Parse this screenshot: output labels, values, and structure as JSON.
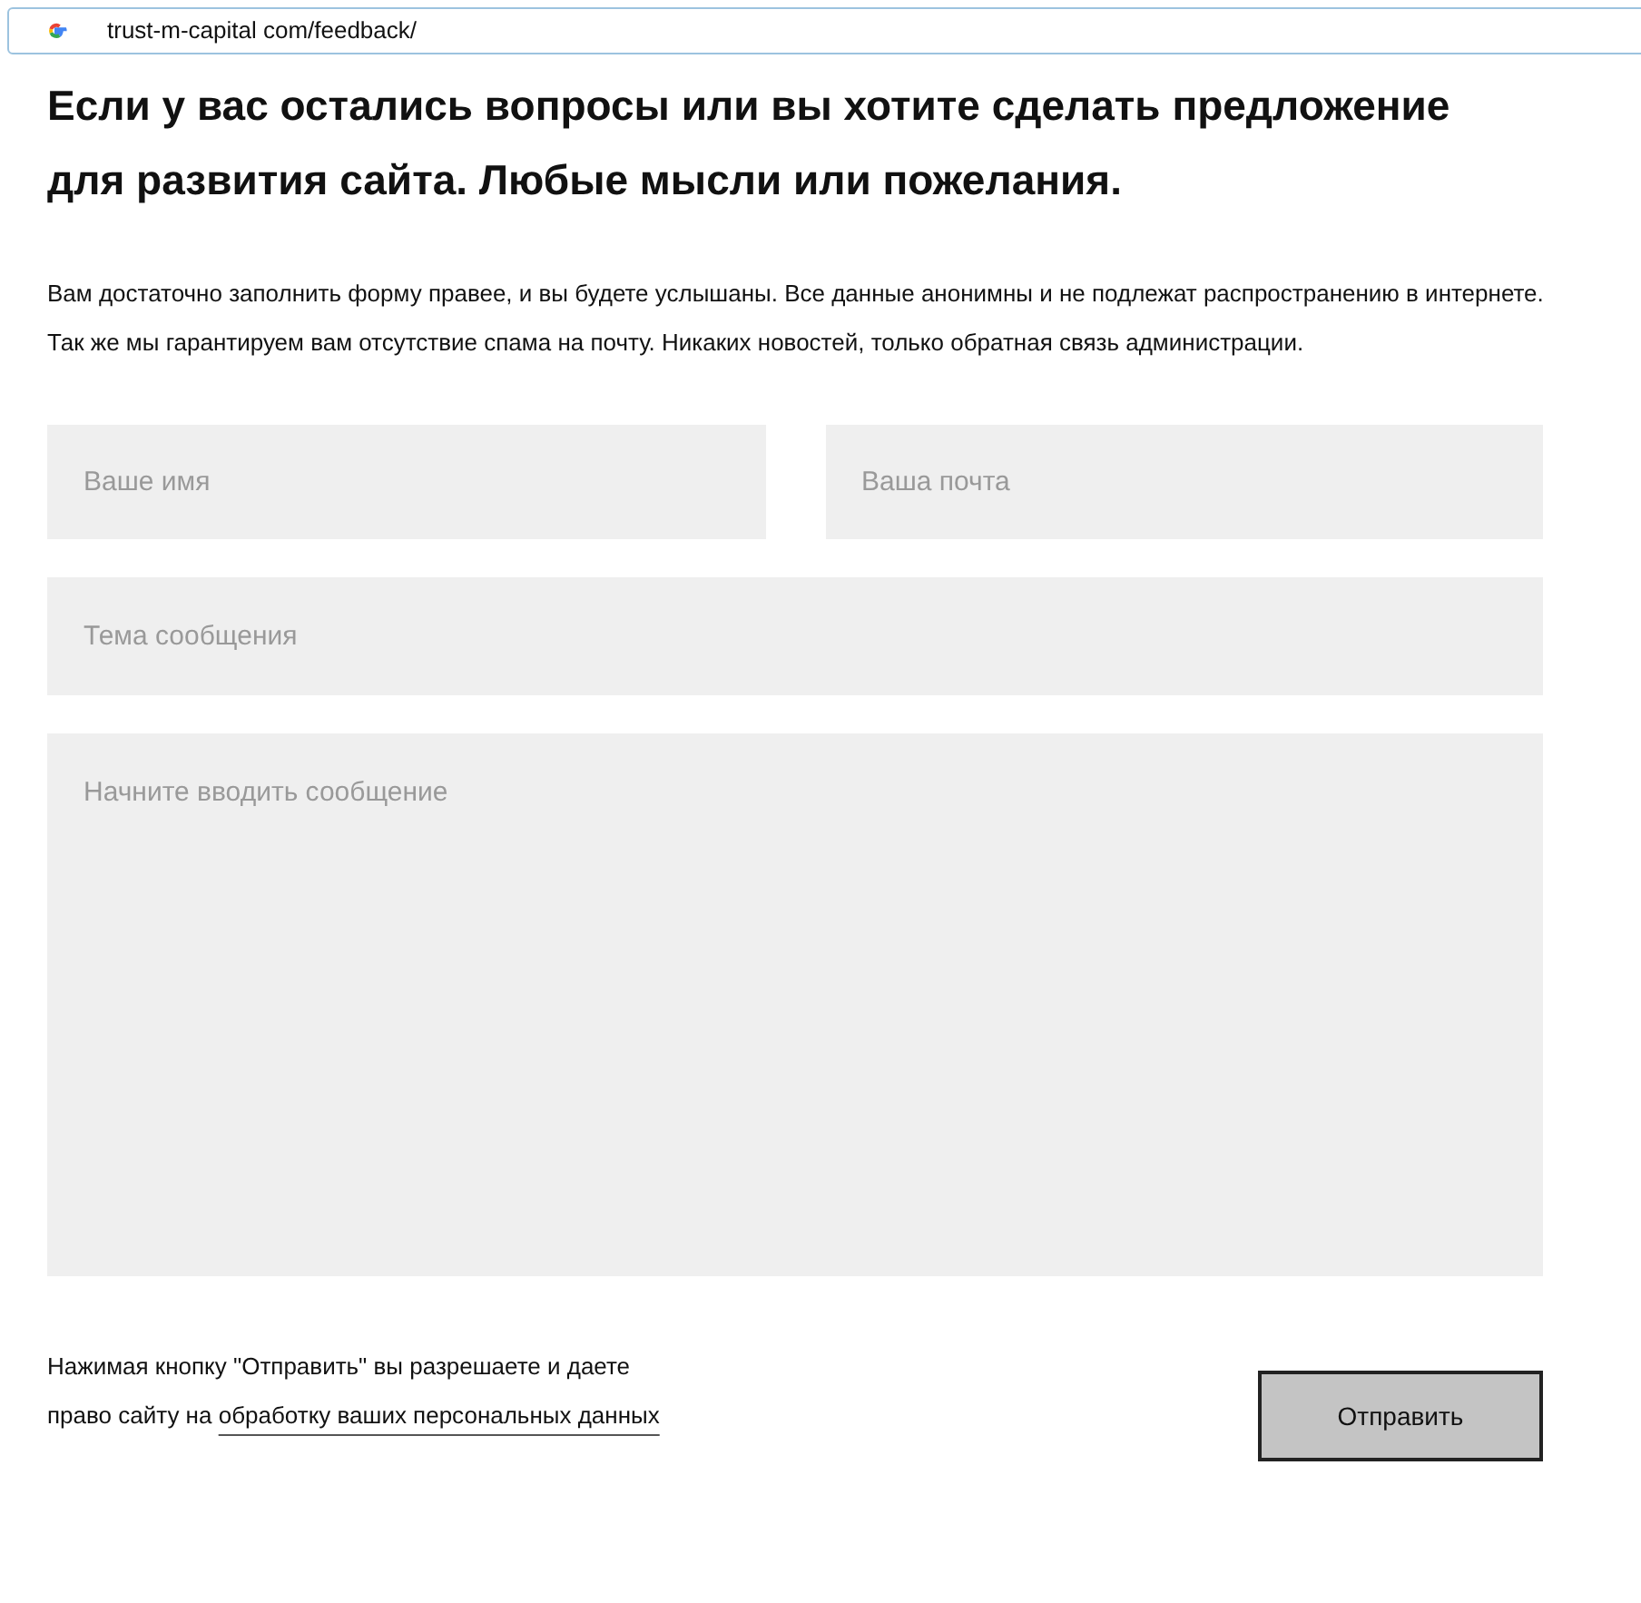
{
  "address_bar": {
    "url": "trust-m-capital com/feedback/"
  },
  "heading": "Если у вас остались вопросы или вы хотите сделать предложение для развития сайта. Любые мысли или пожелания.",
  "intro": "Вам достаточно заполнить форму правее, и вы будете услышаны. Все данные анонимны и не подлежат распространению в интернете. Так же мы гарантируем вам отсутствие спама на почту. Никаких новостей, только обратная связь администрации.",
  "form": {
    "name": {
      "placeholder": "Ваше имя"
    },
    "email": {
      "placeholder": "Ваша почта"
    },
    "subject": {
      "placeholder": "Тема сообщения"
    },
    "message": {
      "placeholder": "Начните вводить сообщение"
    }
  },
  "consent": {
    "text": "Нажимая кнопку \"Отправить\" вы разрешаете и даете право сайту на",
    "link": "обработку ваших персональных данных"
  },
  "submit_button": "Отправить"
}
